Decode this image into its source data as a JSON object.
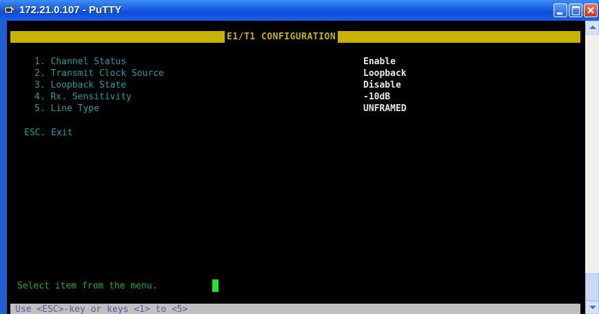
{
  "window": {
    "title": "172.21.0.107 - PuTTY",
    "app_icon": "putty-icon",
    "controls": [
      "minimize-icon",
      "maximize-icon",
      "close-icon"
    ]
  },
  "terminal": {
    "header": "E1/T1 CONFIGURATION",
    "menu": [
      {
        "label": "1. Channel Status",
        "value": "Enable"
      },
      {
        "label": "2. Transmit Clock Source",
        "value": "Loopback"
      },
      {
        "label": "3. Loopback State",
        "value": "Disable"
      },
      {
        "label": "4. Rx. Sensitivity",
        "value": "-10dB"
      },
      {
        "label": "5. Line Type",
        "value": "UNFRAMED"
      }
    ],
    "esc_exit": "ESC. Exit",
    "prompt": "Select item from the menu.",
    "status_line": "Use <ESC>-key or keys <1> to <5>"
  },
  "colors": {
    "header_bar": "#c8b400",
    "menu_text": "#1f9f9f",
    "value_text": "#e8e8e8",
    "prompt_text": "#1faf30",
    "cursor": "#22e622",
    "status_bar": "#c0c0c0"
  }
}
